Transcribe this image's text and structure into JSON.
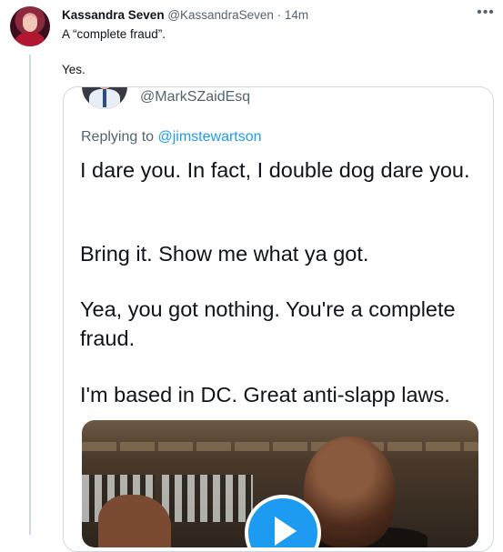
{
  "tweet": {
    "author_name": "Kassandra Seven",
    "author_handle": "@KassandraSeven",
    "time_sep": " · ",
    "time": "14m",
    "more_icon": "more-horizontal-icon",
    "text_line1": "A “complete fraud”.",
    "text_line2": "Yes."
  },
  "quoted": {
    "handle": "@MarkSZaidEsq",
    "replying_prefix": "Replying to ",
    "replying_to": "@jimstewartson",
    "paragraph1": "I dare you. In fact, I double dog dare you.",
    "paragraph2": "Bring it. Show me what ya got.",
    "paragraph3": "Yea, you got nothing. You're a complete fraud.",
    "paragraph4": "I'm based in DC. Great anti-slapp laws.",
    "media_icon": "play-icon"
  },
  "colors": {
    "link": "#1d9bf0",
    "secondary_text": "#536471",
    "primary_text": "#0f1419"
  }
}
